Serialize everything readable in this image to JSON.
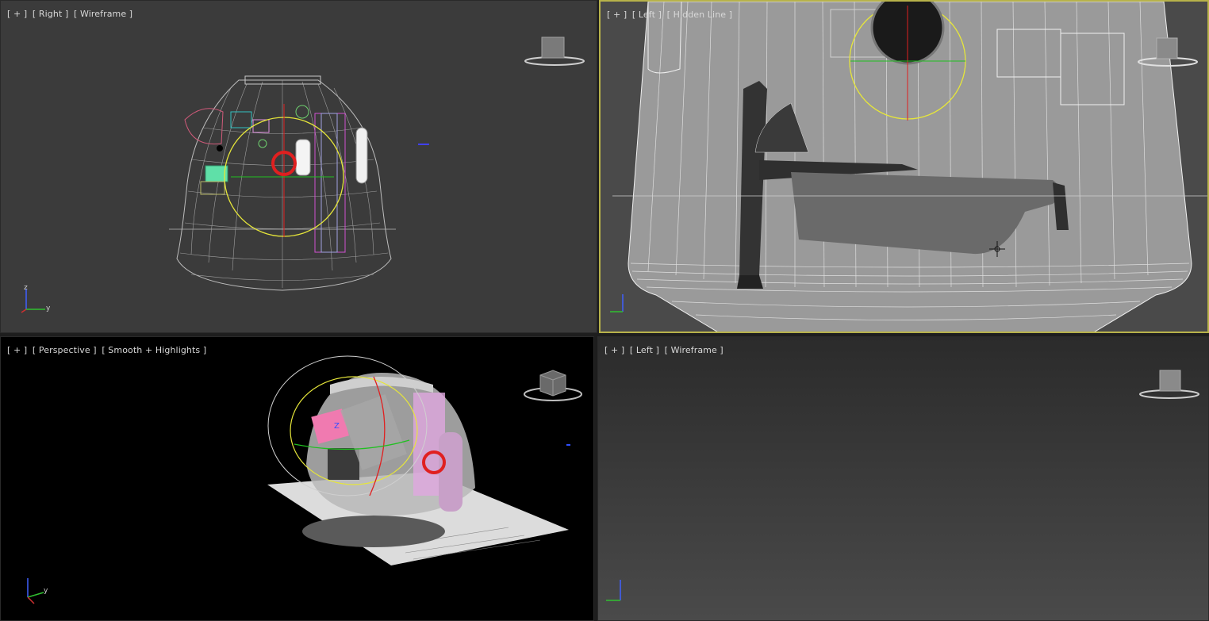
{
  "viewports": {
    "top_left": {
      "labels": [
        "[ + ]",
        "[ Right ]",
        "[ Wireframe ]"
      ],
      "viewcube_face": "RIGHT",
      "axis": {
        "v": "z",
        "h": "y"
      }
    },
    "top_right": {
      "labels": [
        "[ + ]",
        "[ Left ]",
        "[ Hidden Line ]"
      ],
      "viewcube_face": "LEFT",
      "axis": {
        "v": "",
        "h": ""
      }
    },
    "bottom_left": {
      "labels": [
        "[ + ]",
        "[ Perspective ]",
        "[ Smooth + Highlights ]"
      ],
      "axis": {
        "v": "",
        "h": "y"
      },
      "gizmo_axis_label": "Z"
    },
    "bottom_right": {
      "labels": [
        "[ + ]",
        "[ Left ]",
        "[ Wireframe ]"
      ],
      "viewcube_face": "LEFT",
      "axis": {
        "v": "",
        "h": ""
      }
    }
  },
  "colors": {
    "active_border": "#b7b24a",
    "gizmo_yellow": "#e6e63a",
    "gizmo_red": "#e02020",
    "gizmo_green": "#20c020",
    "axis_red": "#d03030",
    "axis_green": "#30c030",
    "axis_blue": "#4060ff"
  },
  "icons": [
    "viewcube-icon",
    "axis-tripod-icon",
    "transform-gizmo-icon",
    "move-cursor-icon"
  ]
}
